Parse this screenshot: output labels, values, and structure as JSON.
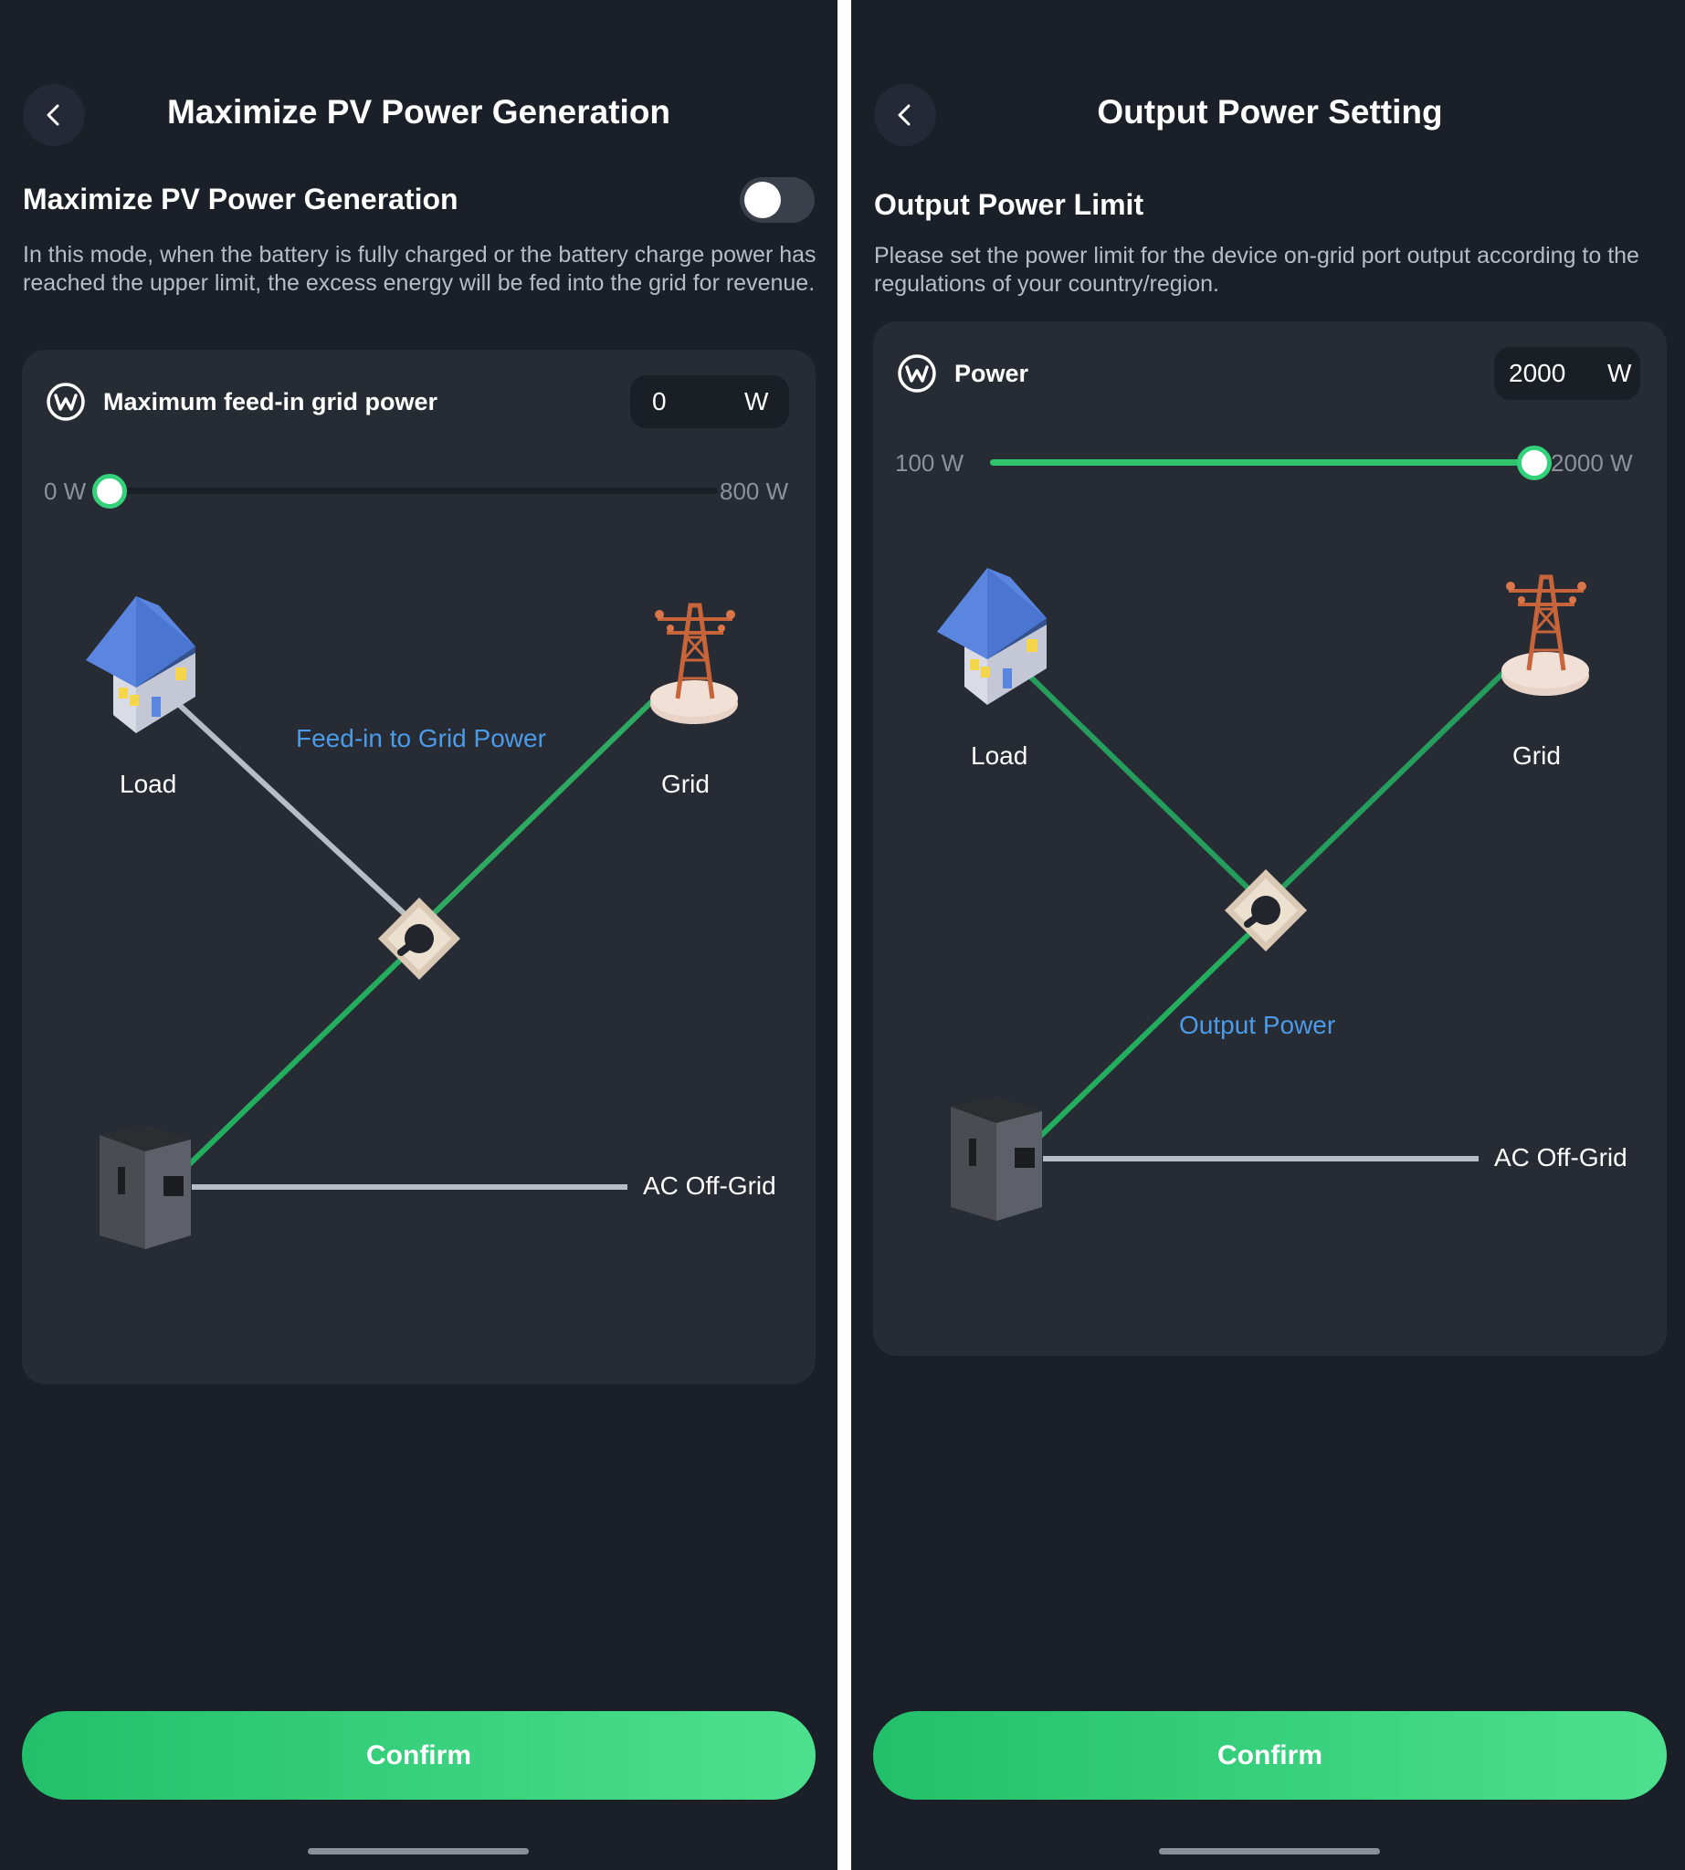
{
  "left": {
    "header": {
      "title": "Maximize PV Power Generation"
    },
    "mode": {
      "title": "Maximize PV Power Generation",
      "toggle_on": false,
      "description": "In this mode, when the battery is fully charged or the battery charge power has reached the upper limit, the excess energy will be fed into the grid for revenue."
    },
    "setting": {
      "icon": "watt-icon",
      "label": "Maximum feed-in grid power",
      "value": "0",
      "unit": "W",
      "slider": {
        "min_label": "0 W",
        "max_label": "800 W",
        "min": 0,
        "max": 800,
        "value": 0
      }
    },
    "diagram": {
      "load_label": "Load",
      "grid_label": "Grid",
      "offgrid_label": "AC Off-Grid",
      "flow_label": "Feed-in to Grid Power"
    },
    "confirm_label": "Confirm"
  },
  "right": {
    "header": {
      "title": "Output Power Setting"
    },
    "section": {
      "title": "Output Power Limit",
      "description": "Please set the power limit for the device on-grid port output according to the regulations of your country/region."
    },
    "setting": {
      "icon": "watt-icon",
      "label": "Power",
      "value": "2000",
      "unit": "W",
      "slider": {
        "min_label": "100 W",
        "max_label": "2000 W",
        "min": 100,
        "max": 2000,
        "value": 2000
      }
    },
    "diagram": {
      "load_label": "Load",
      "grid_label": "Grid",
      "offgrid_label": "AC Off-Grid",
      "flow_label": "Output Power"
    },
    "confirm_label": "Confirm"
  },
  "colors": {
    "background": "#1b1f27",
    "card": "#262b34",
    "accent_green": "#33d17a",
    "flow_blue": "#4c9be8"
  }
}
